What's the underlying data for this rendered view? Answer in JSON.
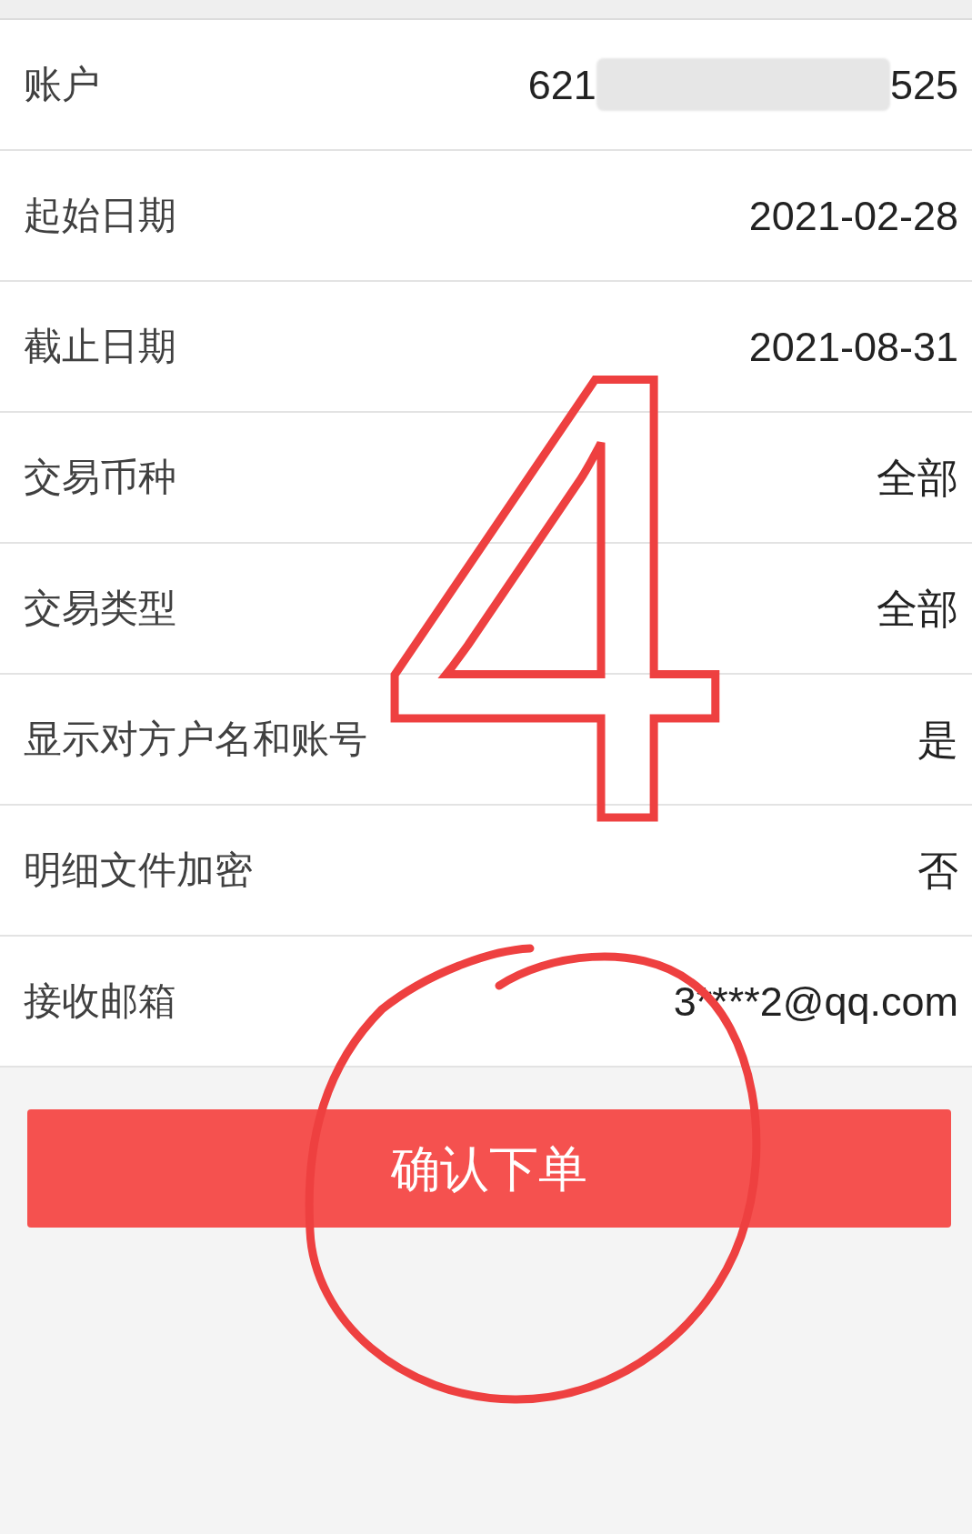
{
  "rows": [
    {
      "kind": "masked",
      "label": "账户",
      "value_parts": [
        "621",
        "525"
      ]
    },
    {
      "kind": "text",
      "label": "起始日期",
      "value": "2021-02-28"
    },
    {
      "kind": "text",
      "label": "截止日期",
      "value": "2021-08-31"
    },
    {
      "kind": "text",
      "label": "交易币种",
      "value": "全部"
    },
    {
      "kind": "text",
      "label": "交易类型",
      "value": "全部"
    },
    {
      "kind": "text",
      "label": "显示对方户名和账号",
      "value": "是"
    },
    {
      "kind": "text",
      "label": "明细文件加密",
      "value": "否"
    },
    {
      "kind": "text",
      "label": "接收邮箱",
      "value": "3****2@qq.com"
    }
  ],
  "submit_button": {
    "label": "确认下单"
  },
  "annotations": [
    {
      "kind": "numeral",
      "text": "4"
    },
    {
      "kind": "circle"
    }
  ]
}
